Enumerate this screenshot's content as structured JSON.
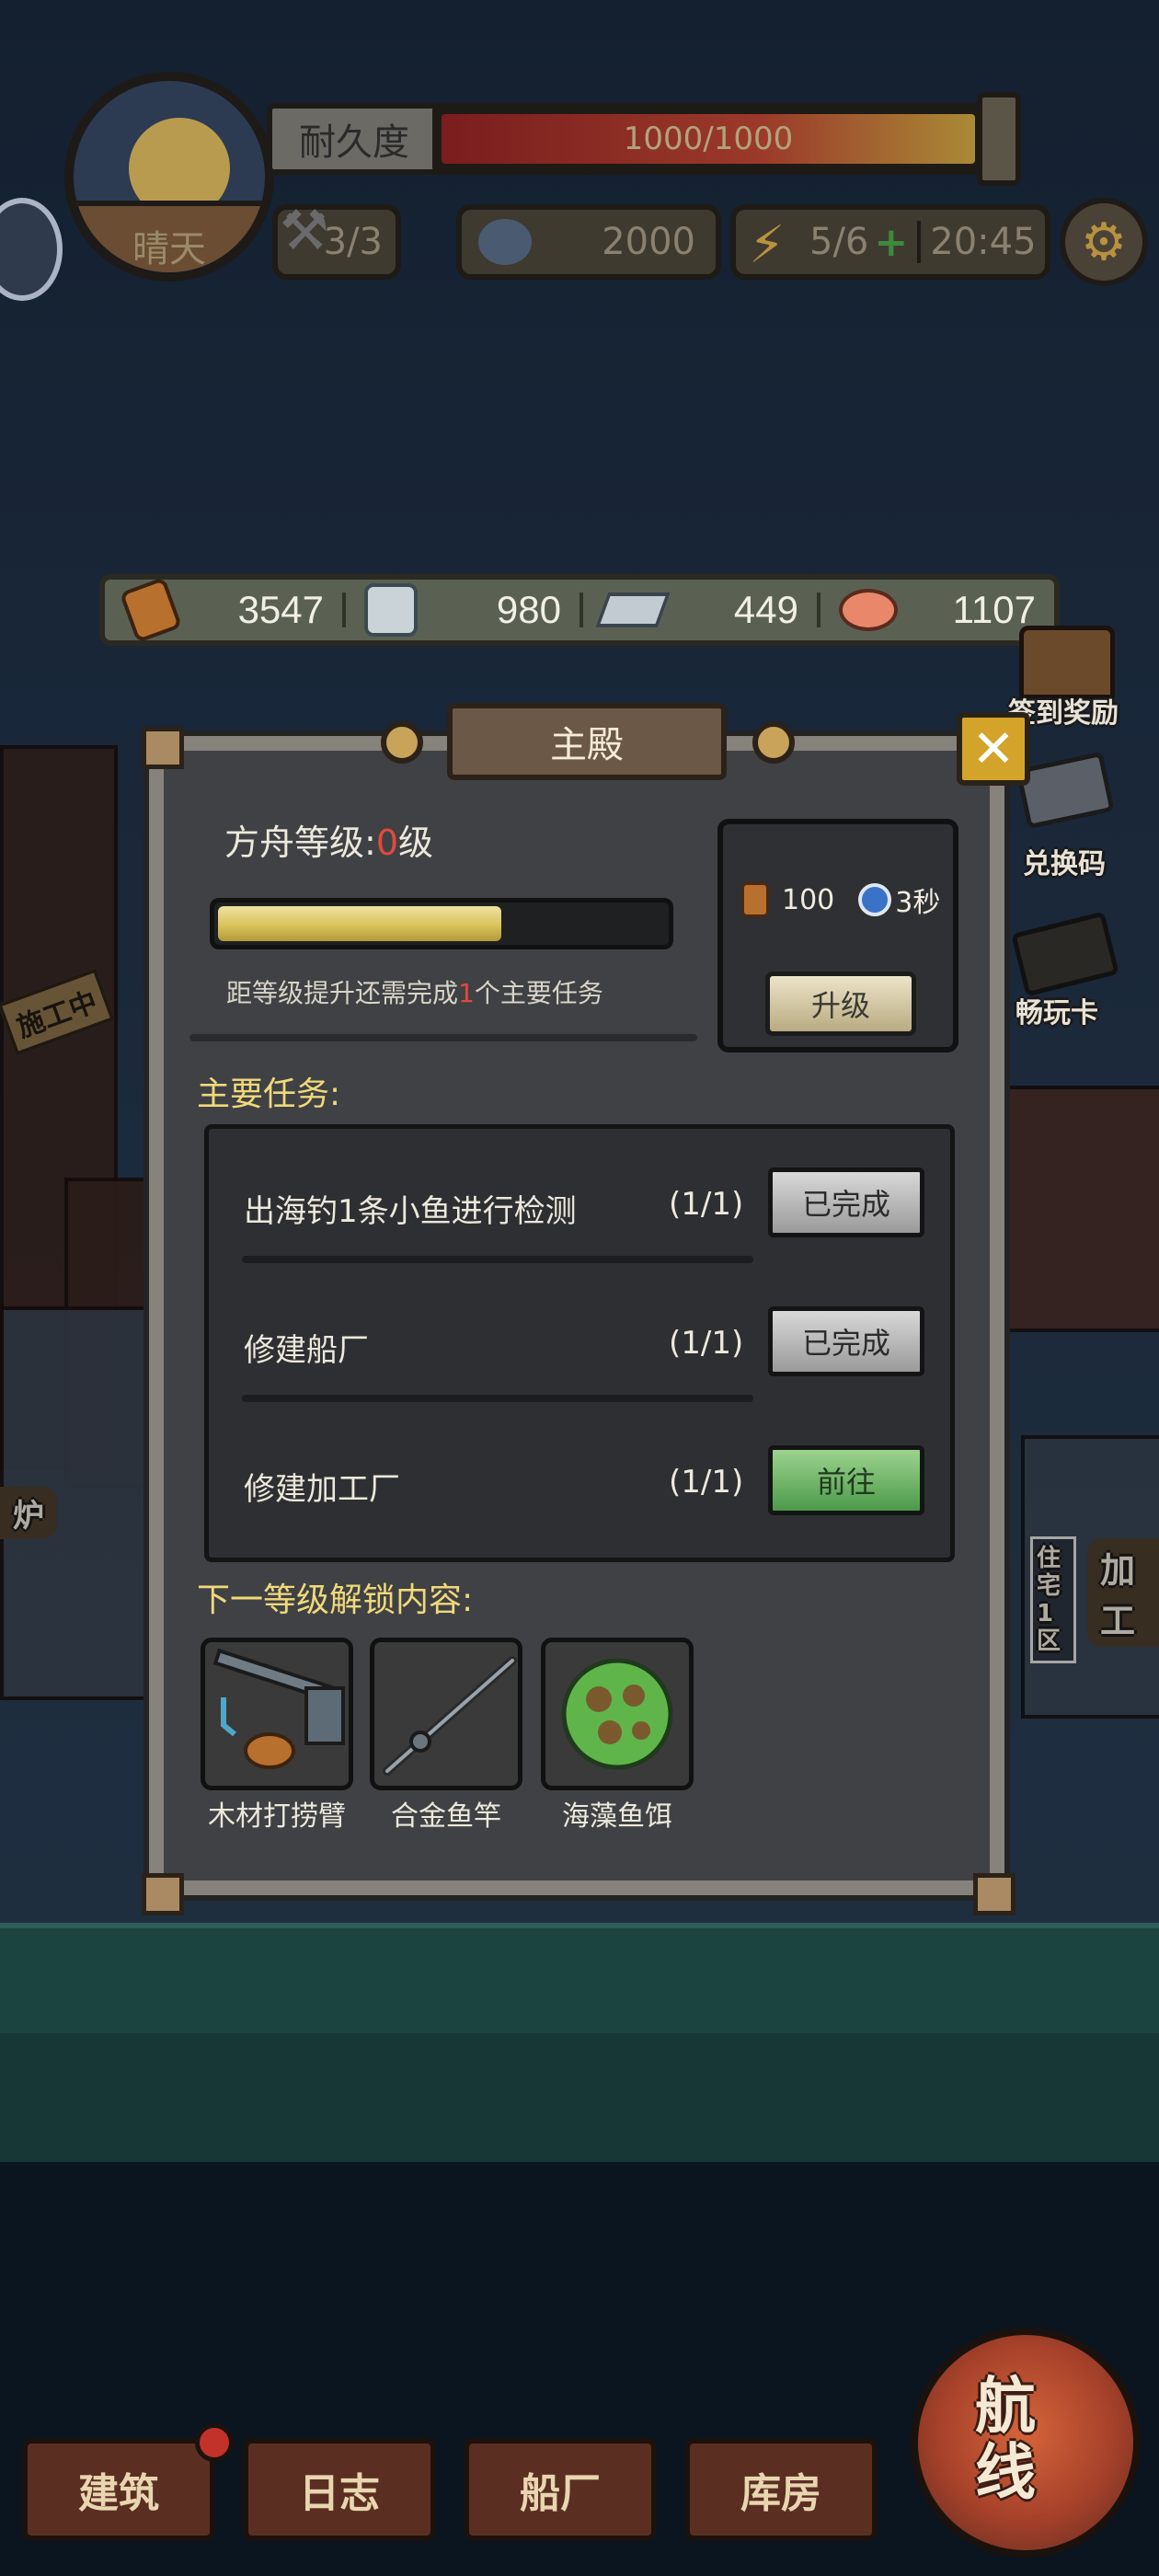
{
  "hud": {
    "weather": "晴天",
    "durability_label": "耐久度",
    "durability_value": "1000/1000",
    "durability_fraction": 1.0,
    "hammer_count": "3/3",
    "coin_amount": "2000",
    "energy": "5/6",
    "energy_timer": "20:45"
  },
  "resources": {
    "wood": "3547",
    "log": "980",
    "iron": "449",
    "fish": "1107"
  },
  "side_shortcuts": {
    "signin": "签到奖励",
    "redeem": "兑换码",
    "card": "畅玩卡",
    "construction": "施工中",
    "left_partial": "炉",
    "residence": "住宅1区",
    "right_partial": "加工"
  },
  "dialog": {
    "title": "主殿",
    "ark_level_label": "方舟等级:",
    "ark_level_value": "0",
    "ark_level_unit": "级",
    "level_progress": 0.64,
    "hint_prefix": "距等级提升还需完成",
    "hint_count": "1",
    "hint_suffix": "个主要任务",
    "cost_wood": "100",
    "cost_time": "3秒",
    "upgrade_label": "升级",
    "main_tasks_title": "主要任务:",
    "tasks": [
      {
        "name": "出海钓1条小鱼进行检测",
        "progress": "(1/1)",
        "action": "已完成"
      },
      {
        "name": "修建船厂",
        "progress": "(1/1)",
        "action": "已完成"
      },
      {
        "name": "修建加工厂",
        "progress": "(1/1)",
        "action": "前往"
      }
    ],
    "unlock_title": "下一等级解锁内容:",
    "unlocks": [
      {
        "name": "木材打捞臂"
      },
      {
        "name": "合金鱼竿"
      },
      {
        "name": "海藻鱼饵"
      }
    ]
  },
  "bottom_nav": {
    "build": "建筑",
    "log": "日志",
    "shipyard": "船厂",
    "warehouse": "库房",
    "voyage": "航线"
  },
  "colors": {
    "accent_gold": "#f0d97a",
    "alert_red": "#e24a3a",
    "go_green": "#4c9a4a"
  }
}
